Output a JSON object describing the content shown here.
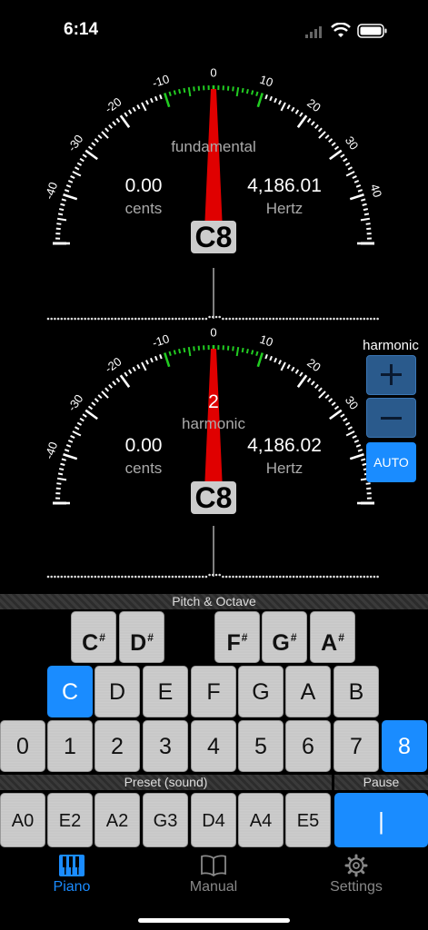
{
  "status": {
    "time": "6:14"
  },
  "scale_labels": [
    "-40",
    "-30",
    "-20",
    "-10",
    "0",
    "10",
    "20",
    "30",
    "40"
  ],
  "meter_top": {
    "label": "fundamental",
    "cents_value": "0.00",
    "cents_label": "cents",
    "hertz_value": "4,186.01",
    "hertz_label": "Hertz",
    "note": "C8"
  },
  "meter_bottom": {
    "harmonic_number": "2",
    "label": "harmonic",
    "cents_value": "0.00",
    "cents_label": "cents",
    "hertz_value": "4,186.02",
    "hertz_label": "Hertz",
    "note": "C8"
  },
  "harmonic_panel": {
    "title": "harmonic",
    "plus_icon": "plus-icon",
    "minus_icon": "minus-icon",
    "auto_label": "AUTO"
  },
  "keyboard": {
    "section_title": "Pitch & Octave",
    "sharps": [
      {
        "note": "C",
        "mark": "#"
      },
      {
        "note": "D",
        "mark": "#"
      },
      {
        "note": "F",
        "mark": "#"
      },
      {
        "note": "G",
        "mark": "#"
      },
      {
        "note": "A",
        "mark": "#"
      }
    ],
    "naturals": [
      "C",
      "D",
      "E",
      "F",
      "G",
      "A",
      "B"
    ],
    "selected_note": "C",
    "octaves": [
      "0",
      "1",
      "2",
      "3",
      "4",
      "5",
      "6",
      "7",
      "8"
    ],
    "selected_octave": "8"
  },
  "preset": {
    "section_title": "Preset (sound)",
    "items": [
      "A0",
      "E2",
      "A2",
      "G3",
      "D4",
      "A4",
      "E5"
    ]
  },
  "pause": {
    "section_title": "Pause",
    "button_label": "|"
  },
  "tabs": [
    {
      "label": "Piano",
      "icon": "piano-icon"
    },
    {
      "label": "Manual",
      "icon": "book-icon"
    },
    {
      "label": "Settings",
      "icon": "gear-icon"
    }
  ],
  "colors": {
    "accent": "#1a8cff",
    "needle": "#e00000",
    "in_tune": "#22cc22"
  }
}
